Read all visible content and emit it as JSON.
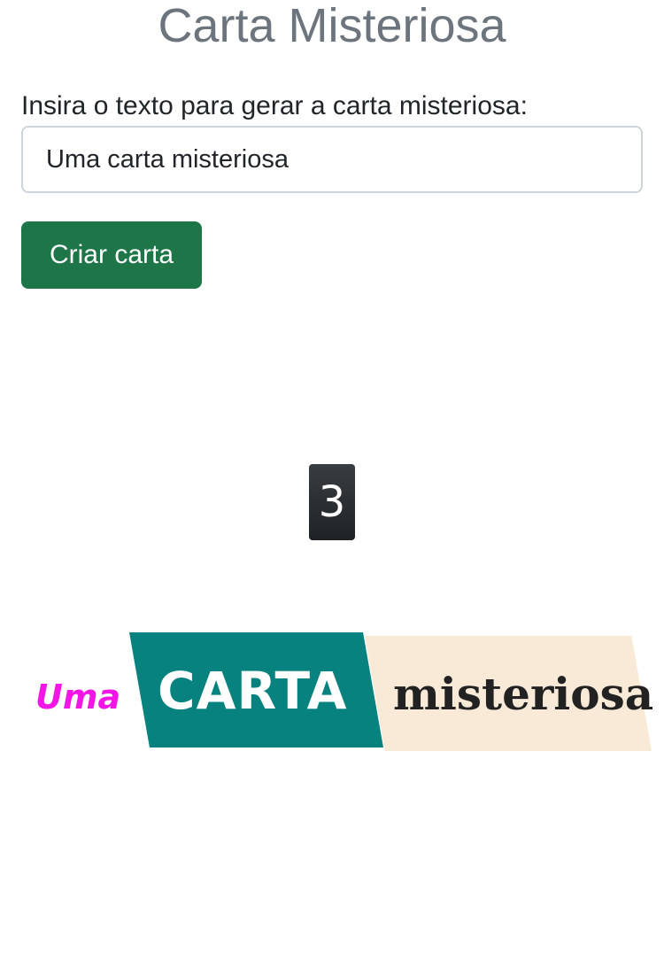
{
  "header": {
    "title": "Carta Misteriosa"
  },
  "form": {
    "label": "Insira o texto para gerar a carta misteriosa:",
    "input_value": "Uma carta misteriosa",
    "button_label": "Criar carta"
  },
  "card": {
    "words": [
      "Uma",
      "CARTA",
      "misteriosa"
    ],
    "colors": {
      "uma_text": "#f314e6",
      "carta_bg": "#07827e",
      "carta_text": "#ffffff",
      "misteriosa_bg": "#f8ead7",
      "misteriosa_text": "#222222"
    }
  },
  "counter": {
    "value": "3"
  },
  "theme": {
    "title_color": "#6c757d",
    "button_color": "#1e7548",
    "input_border": "#ced4da"
  }
}
